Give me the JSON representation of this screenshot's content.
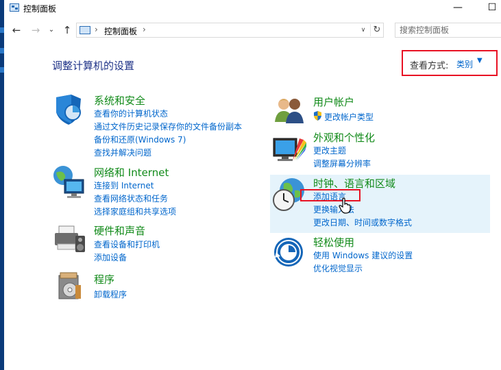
{
  "window": {
    "title": "控制面板",
    "minimize": "—",
    "maximize": "☐"
  },
  "nav": {
    "breadcrumb": "控制面板",
    "search_placeholder": "搜索控制面板"
  },
  "header": {
    "title": "调整计算机的设置",
    "view_label": "查看方式:",
    "view_value": "类别"
  },
  "categories": {
    "system_security": {
      "title": "系统和安全",
      "links": [
        "查看你的计算机状态",
        "通过文件历史记录保存你的文件备份副本",
        "备份和还原(Windows 7)",
        "查找并解决问题"
      ]
    },
    "network": {
      "title": "网络和 Internet",
      "links": [
        "连接到 Internet",
        "查看网络状态和任务",
        "选择家庭组和共享选项"
      ]
    },
    "hardware": {
      "title": "硬件和声音",
      "links": [
        "查看设备和打印机",
        "添加设备"
      ]
    },
    "programs": {
      "title": "程序",
      "links": [
        "卸载程序"
      ]
    },
    "user_accounts": {
      "title": "用户帐户",
      "links": [
        "更改帐户类型"
      ]
    },
    "appearance": {
      "title": "外观和个性化",
      "links": [
        "更改主题",
        "调整屏幕分辨率"
      ]
    },
    "clock_region": {
      "title": "时钟、语言和区域",
      "links": [
        "添加语言",
        "更换输入法",
        "更改日期、时间或数字格式"
      ]
    },
    "ease_access": {
      "title": "轻松使用",
      "links": [
        "使用 Windows 建议的设置",
        "优化视觉显示"
      ]
    }
  },
  "colors": {
    "category_title": "#118a19",
    "link": "#0066cc",
    "highlight": "#e81123",
    "hover_panel": "#e5f3fb"
  }
}
